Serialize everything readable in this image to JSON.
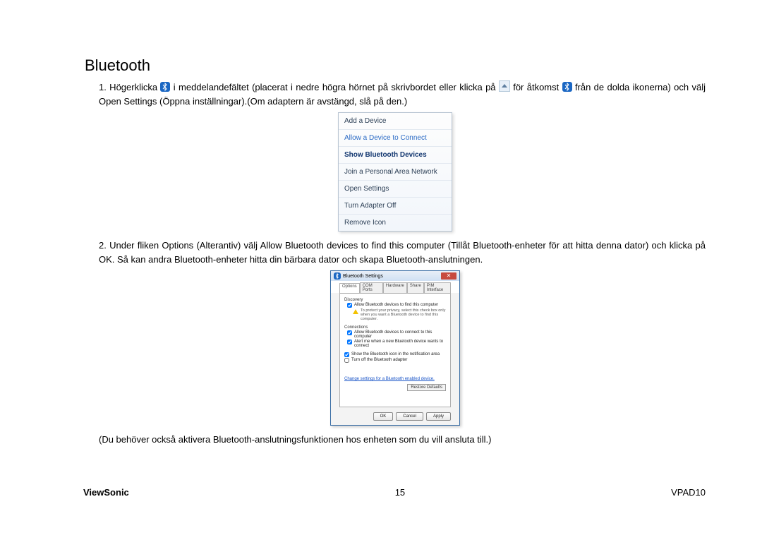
{
  "title": "Bluetooth",
  "step1": {
    "lead": "1. Högerklicka ",
    "afterIcon1": " i meddelandefältet (placerat i nedre högra hörnet på skrivbordet eller klicka på ",
    "afterBox": " för åtkomst ",
    "afterIcon2": " från de dolda ikonerna) och välj Open Settings (Öppna inställningar).(Om adaptern är avstängd, slå på den.)"
  },
  "contextMenu": {
    "items": [
      {
        "label": "Add a Device",
        "style": "norm"
      },
      {
        "label": "Allow a Device to Connect",
        "style": "link"
      },
      {
        "label": "Show Bluetooth Devices",
        "style": "bold"
      },
      {
        "label": "Join a Personal Area Network",
        "style": "norm"
      },
      {
        "label": "Open Settings",
        "style": "norm"
      },
      {
        "label": "Turn Adapter Off",
        "style": "norm"
      },
      {
        "label": "Remove Icon",
        "style": "norm"
      }
    ]
  },
  "step2": "2. Under fliken Options (Alterantiv) välj Allow Bluetooth devices to find this computer (Tillåt Bluetooth-enheter för att hitta denna dator) och klicka på OK. Så kan andra Bluetooth-enheter hitta din bärbara dator och skapa Bluetooth-anslutningen.",
  "dialog": {
    "title": "Bluetooth Settings",
    "tabs": [
      "Options",
      "COM Ports",
      "Hardware",
      "Share",
      "PIM Interface"
    ],
    "discovery": {
      "header": "Discovery",
      "allow": "Allow Bluetooth devices to find this computer",
      "warn": "To protect your privacy, select this check box only when you want a Bluetooth device to find this computer."
    },
    "connections": {
      "header": "Connections",
      "c1": "Allow Bluetooth devices to connect to this computer",
      "c2": "Alert me when a new Bluetooth device wants to connect"
    },
    "opt1": "Show the Bluetooth icon in the notification area",
    "opt2": "Turn off the Bluetooth adapter",
    "link": "Change settings for a Bluetooth enabled device.",
    "restore": "Restore Defaults",
    "ok": "OK",
    "cancel": "Cancel",
    "apply": "Apply"
  },
  "note": "(Du behöver också aktivera Bluetooth-anslutningsfunktionen hos enheten som du vill ansluta till.)",
  "footer": {
    "brand": "ViewSonic",
    "page": "15",
    "model": "VPAD10"
  }
}
